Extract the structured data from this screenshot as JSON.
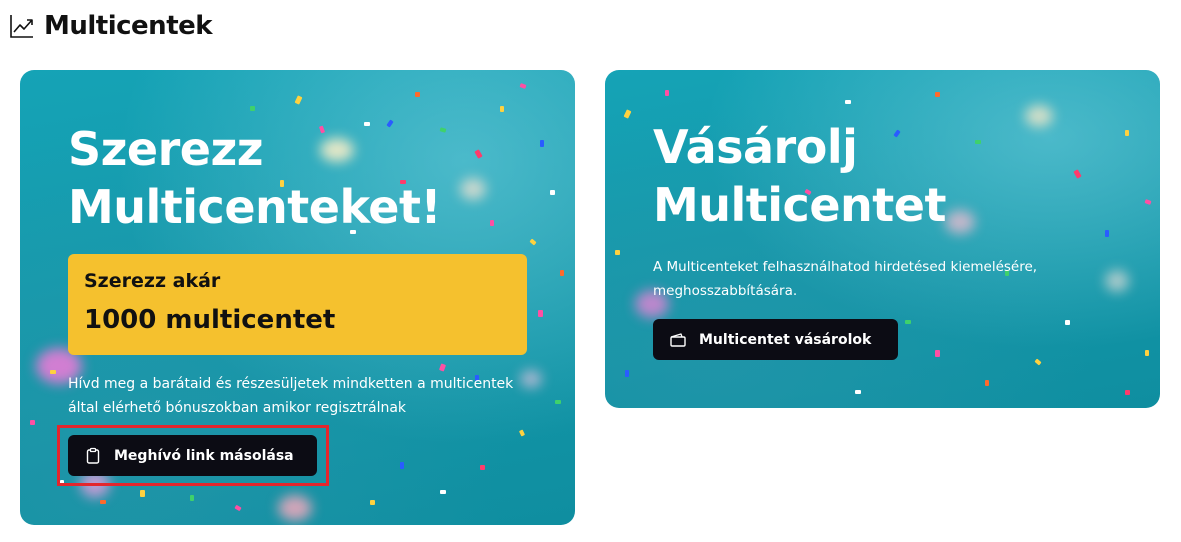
{
  "page": {
    "title": "Multicentek",
    "title_icon": "trending-up-icon"
  },
  "earn_card": {
    "title_line1": "Szerezz",
    "title_line2": "Multicenteket!",
    "promo_line1": "Szerezz akár",
    "promo_line2": "1000 multicentet",
    "description": "Hívd meg a barátaid és részesüljetek mindketten a multicentek által elérhető bónuszokban amikor regisztrálnak",
    "button_label": "Meghívó link másolása",
    "button_icon": "clipboard-icon"
  },
  "buy_card": {
    "title_line1": "Vásárolj",
    "title_line2": "Multicentet",
    "description": "A Multicenteket felhasználhatod hirdetésed kiemelésére, meghosszabbítására.",
    "button_label": "Multicentet vásárolok",
    "button_icon": "wallet-icon"
  },
  "colors": {
    "card_background": "#15a3b6",
    "promo_background": "#f5c12e",
    "button_background": "#0c0c14",
    "highlight_border": "#e3262d"
  }
}
